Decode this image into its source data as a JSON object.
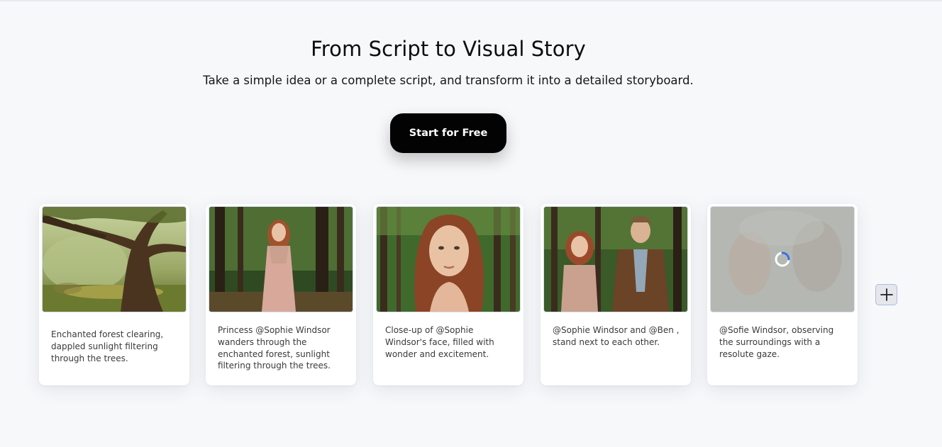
{
  "hero": {
    "title": "From Script to Visual Story",
    "subtitle": "Take a simple idea or a complete script, and transform it into a detailed storyboard.",
    "cta_label": "Start for Free"
  },
  "storyboard": {
    "cards": [
      {
        "caption": "Enchanted forest clearing, dappled sunlight filtering through the trees.",
        "image": "enchanted-forest-tree-image",
        "loading": false
      },
      {
        "caption": "Princess @Sophie Windsor wanders through the enchanted forest, sunlight filtering through the trees.",
        "image": "princess-in-forest-image",
        "loading": false
      },
      {
        "caption": "Close-up of @Sophie Windsor's face, filled with wonder and excitement.",
        "image": "face-closeup-image",
        "loading": false
      },
      {
        "caption": "@Sophie Windsor and @Ben , stand next to each other.",
        "image": "couple-in-forest-image",
        "loading": false
      },
      {
        "caption": "@Sofie Windsor, observing the surroundings with a resolute gaze.",
        "image": "generating-image-placeholder",
        "loading": true
      }
    ],
    "add_icon": "plus-icon",
    "spinner_icon": "loading-spinner-icon"
  },
  "colors": {
    "background": "#f7f8fa",
    "cta_background": "#030303",
    "cta_text": "#ffffff",
    "spinner_accent": "#3b6ee8"
  }
}
